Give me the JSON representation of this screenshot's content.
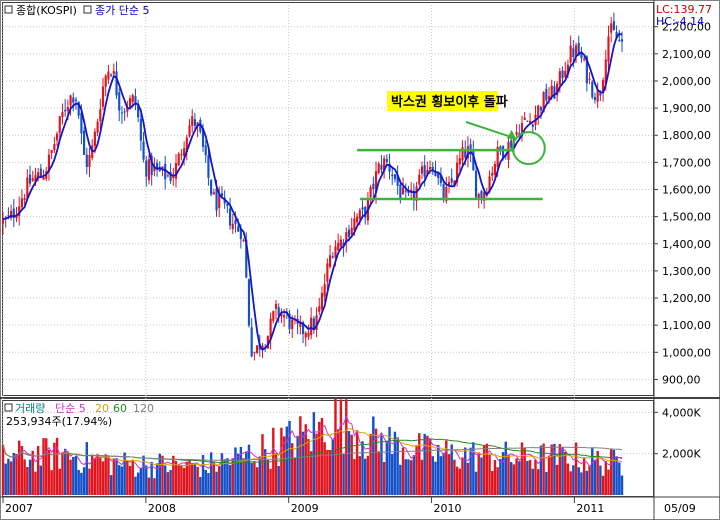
{
  "colors": {
    "up": "#e0141e",
    "down": "#1450c8",
    "ma_price": "#1414c8",
    "annotation_line": "#3cb43c",
    "annotation_bg": "#ffff00",
    "vol_ma5": "#cc33cc",
    "vol_ma20": "#e0a000",
    "vol_ma60": "#228b22",
    "vol_ma120": "#808080",
    "header_blue": "#0000cc",
    "header_red": "#cc0000"
  },
  "price_panel": {
    "title": "종합(KOSPI)",
    "ma_label": "종가 단순 5",
    "lc_label": "LC:139.77",
    "hc_label": "HC:-4.14"
  },
  "volume_panel": {
    "title": "거래량",
    "ma_label": "단순 5",
    "ma20": "20",
    "ma60": "60",
    "ma120": "120",
    "current": "253,934주(17.94%)"
  },
  "annotation": {
    "text": "박스권 횡보이후 돌파"
  },
  "chart_data": [
    {
      "type": "candlestick",
      "title": "종합(KOSPI)",
      "series_name": "종가 단순 5",
      "ylim": [
        850,
        2280
      ],
      "y_ticks": [
        900,
        1000,
        1100,
        1200,
        1300,
        1400,
        1500,
        1600,
        1700,
        1800,
        1900,
        2000,
        2100,
        2200
      ],
      "y_tick_labels": [
        "900,00",
        "1,000,00",
        "1,100,00",
        "1,200,00",
        "1,300,00",
        "1,400,00",
        "1,500,00",
        "1,600,00",
        "1,700,00",
        "1,800,00",
        "1,900,00",
        "2,000,00",
        "2,100,00",
        "2,200,00"
      ],
      "x_labels": [
        "2007",
        "2008",
        "2009",
        "2010",
        "2011",
        "05/09"
      ],
      "date_range": [
        "2007-01",
        "2011-05"
      ],
      "key_points": [
        {
          "date": "2007-01",
          "close": 1480
        },
        {
          "date": "2007-04",
          "close": 1650
        },
        {
          "date": "2007-07",
          "close": 1950
        },
        {
          "date": "2007-08",
          "close": 1700
        },
        {
          "date": "2007-10",
          "close": 2050
        },
        {
          "date": "2007-11",
          "close": 1900
        },
        {
          "date": "2007-12",
          "close": 1930
        },
        {
          "date": "2008-01",
          "close": 1680
        },
        {
          "date": "2008-03",
          "close": 1650
        },
        {
          "date": "2008-05",
          "close": 1850
        },
        {
          "date": "2008-07",
          "close": 1550
        },
        {
          "date": "2008-09",
          "close": 1450
        },
        {
          "date": "2008-10",
          "close": 1000
        },
        {
          "date": "2008-11",
          "close": 1050
        },
        {
          "date": "2008-12",
          "close": 1150
        },
        {
          "date": "2009-02",
          "close": 1080
        },
        {
          "date": "2009-03",
          "close": 1100
        },
        {
          "date": "2009-05",
          "close": 1400
        },
        {
          "date": "2009-07",
          "close": 1500
        },
        {
          "date": "2009-09",
          "close": 1700
        },
        {
          "date": "2009-11",
          "close": 1560
        },
        {
          "date": "2010-01",
          "close": 1700
        },
        {
          "date": "2010-02",
          "close": 1580
        },
        {
          "date": "2010-04",
          "close": 1740
        },
        {
          "date": "2010-05",
          "close": 1580
        },
        {
          "date": "2010-07",
          "close": 1750
        },
        {
          "date": "2010-09",
          "close": 1850
        },
        {
          "date": "2010-11",
          "close": 1950
        },
        {
          "date": "2011-01",
          "close": 2110
        },
        {
          "date": "2011-03",
          "close": 1950
        },
        {
          "date": "2011-04",
          "close": 2180
        },
        {
          "date": "2011-05",
          "close": 2140
        }
      ],
      "box_range": {
        "upper": 1745,
        "lower": 1565
      }
    },
    {
      "type": "bar",
      "title": "거래량",
      "ylim": [
        0,
        4500
      ],
      "y_ticks": [
        2000,
        4000
      ],
      "y_tick_labels": [
        "2,000K",
        "4,000K"
      ],
      "moving_averages": [
        "단순 5",
        "20",
        "60",
        "120"
      ],
      "key_points": [
        {
          "date": "2007-01",
          "volume": 1800
        },
        {
          "date": "2007-06",
          "volume": 2000
        },
        {
          "date": "2007-11",
          "volume": 1500
        },
        {
          "date": "2008-06",
          "volume": 1400
        },
        {
          "date": "2008-10",
          "volume": 2000
        },
        {
          "date": "2009-03",
          "volume": 3000
        },
        {
          "date": "2009-05",
          "volume": 3600
        },
        {
          "date": "2009-08",
          "volume": 2700
        },
        {
          "date": "2010-01",
          "volume": 2000
        },
        {
          "date": "2010-08",
          "volume": 1800
        },
        {
          "date": "2011-01",
          "volume": 1800
        },
        {
          "date": "2011-05",
          "volume": 1500
        }
      ]
    }
  ]
}
